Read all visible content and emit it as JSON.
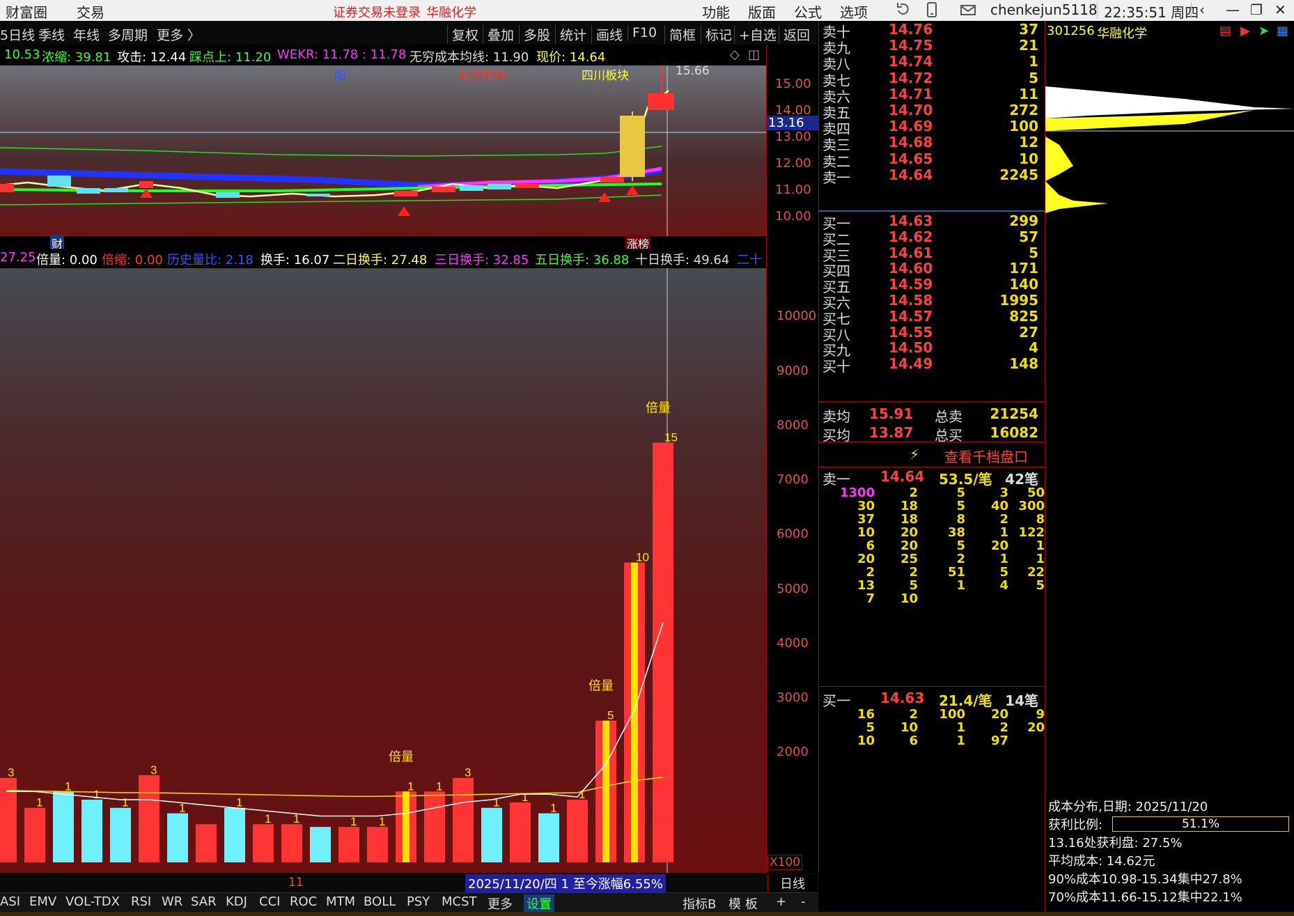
{
  "menu": {
    "left_items": [
      "财富圈",
      "交易"
    ],
    "notice": "证券交易未登录",
    "stock_name": "华融化学",
    "right_items": [
      "功能",
      "版面",
      "公式",
      "选项"
    ],
    "user": "chenkejun5118",
    "time": "22:35:51 周四"
  },
  "period_bar": {
    "items": [
      "5日线",
      "季线",
      "年线",
      "多周期",
      "更多 〉"
    ],
    "tools": [
      "复权",
      "叠加",
      "多股",
      "统计",
      "画线",
      "F10",
      "简框",
      "标记",
      "+自选",
      "返回"
    ]
  },
  "indicator_line": [
    {
      "text": "10.53",
      "color": "#33ff33"
    },
    {
      "text": "浓缩: 39.81",
      "color": "#33ff33"
    },
    {
      "text": "攻击: 12.44",
      "color": "#ffffff"
    },
    {
      "text": "踩点上: 11.20",
      "color": "#33ff33"
    },
    {
      "text": "WEKR: 11.78 : 11.78",
      "color": "#ff33ff"
    },
    {
      "text": "无穷成本均线: 11.90",
      "color": "#dddddd"
    },
    {
      "text": "现价: 14.64",
      "color": "#ffff33"
    }
  ],
  "price_chart": {
    "labels": [
      {
        "text": "阳",
        "color": "#3355ff"
      },
      {
        "text": "化学原料",
        "color": "#ff3333"
      },
      {
        "text": "四川板块",
        "color": "#ffff33"
      }
    ],
    "high_label": "15.66",
    "crosshair_price": "13.16",
    "y_ticks": [
      "15.00",
      "14.00",
      "13.00",
      "12.00",
      "11.00",
      "10.00"
    ],
    "tag_cai": "财",
    "tag_zhangbang": "涨榜"
  },
  "volume_indicator_line": [
    {
      "text": "27.25",
      "color": "#ff33ff"
    },
    {
      "text": "倍量: 0.00",
      "color": "#ffffff"
    },
    {
      "text": "倍缩: 0.00",
      "color": "#ff3333"
    },
    {
      "text": "历史量比: 2.18",
      "color": "#3355ff"
    },
    {
      "text": "换手: 16.07",
      "color": "#ffffff"
    },
    {
      "text": "二日换手: 27.48",
      "color": "#ffff33"
    },
    {
      "text": "三日换手: 32.85",
      "color": "#ff33ff"
    },
    {
      "text": "五日换手: 36.88",
      "color": "#33ff33"
    },
    {
      "text": "十日换手: 49.64",
      "color": "#dddddd"
    },
    {
      "text": "二十",
      "color": "#3355ff"
    }
  ],
  "chart_data": {
    "type": "bar",
    "title": "",
    "xlabel": "",
    "ylabel": "",
    "ylim": [
      0,
      10900
    ],
    "y_ticks": [
      2000,
      3000,
      4000,
      5000,
      6000,
      7000,
      8000,
      9000,
      10000
    ],
    "y_unit_label": "X100",
    "volumes": [
      1550,
      1000,
      1300,
      1150,
      1000,
      1600,
      900,
      700,
      1000,
      700,
      700,
      650,
      650,
      650,
      1300,
      1300,
      1550,
      1000,
      1100,
      900,
      1150,
      2600,
      5500,
      7700
    ],
    "colors": [
      "red",
      "red",
      "cyan",
      "cyan",
      "cyan",
      "red",
      "cyan",
      "red",
      "cyan",
      "red",
      "red",
      "cyan",
      "red",
      "red",
      "yellow",
      "red",
      "red",
      "cyan",
      "red",
      "cyan",
      "red",
      "yellow",
      "yellow",
      "red"
    ],
    "bar_labels": [
      "3",
      "1",
      "1",
      "1",
      "1",
      "3",
      "1",
      "",
      "1",
      "1",
      "1",
      "",
      "1",
      "1",
      "1",
      "1",
      "3",
      "1",
      "1",
      "1",
      "1",
      "5",
      "10",
      "15"
    ],
    "annotations": [
      "倍量",
      "倍量",
      "倍量"
    ]
  },
  "date_bar": {
    "month": "11",
    "range_text": "2025/11/20/四 1 至今涨幅6.55%",
    "period": "日线"
  },
  "tabs": [
    "ASI",
    "EMV",
    "VOL-TDX",
    "RSI",
    "WR",
    "SAR",
    "KDJ",
    "CCI",
    "ROC",
    "MTM",
    "BOLL",
    "PSY",
    "MCST",
    "更多",
    "设置"
  ],
  "tabs_right": [
    "指标B",
    "模 板",
    "+",
    "-"
  ],
  "orderbook": {
    "asks": [
      {
        "label": "卖十",
        "price": "14.76",
        "vol": "37"
      },
      {
        "label": "卖九",
        "price": "14.75",
        "vol": "21"
      },
      {
        "label": "卖八",
        "price": "14.74",
        "vol": "1"
      },
      {
        "label": "卖七",
        "price": "14.72",
        "vol": "5"
      },
      {
        "label": "卖六",
        "price": "14.71",
        "vol": "11"
      },
      {
        "label": "卖五",
        "price": "14.70",
        "vol": "272"
      },
      {
        "label": "卖四",
        "price": "14.69",
        "vol": "100"
      },
      {
        "label": "卖三",
        "price": "14.68",
        "vol": "12"
      },
      {
        "label": "卖二",
        "price": "14.65",
        "vol": "10"
      },
      {
        "label": "卖一",
        "price": "14.64",
        "vol": "2245"
      }
    ],
    "bids": [
      {
        "label": "买一",
        "price": "14.63",
        "vol": "299"
      },
      {
        "label": "买二",
        "price": "14.62",
        "vol": "57"
      },
      {
        "label": "买三",
        "price": "14.61",
        "vol": "5"
      },
      {
        "label": "买四",
        "price": "14.60",
        "vol": "171"
      },
      {
        "label": "买五",
        "price": "14.59",
        "vol": "140"
      },
      {
        "label": "买六",
        "price": "14.58",
        "vol": "1995"
      },
      {
        "label": "买七",
        "price": "14.57",
        "vol": "825"
      },
      {
        "label": "买八",
        "price": "14.55",
        "vol": "27"
      },
      {
        "label": "买九",
        "price": "14.50",
        "vol": "4"
      },
      {
        "label": "买十",
        "price": "14.49",
        "vol": "148"
      }
    ],
    "avg_sell_label": "卖均",
    "avg_sell": "15.91",
    "total_sell_label": "总卖",
    "total_sell": "21254",
    "avg_buy_label": "买均",
    "avg_buy": "13.87",
    "total_buy_label": "总买",
    "total_buy": "16082",
    "depth_link": "查看千档盘口",
    "sell1_detail": {
      "label": "卖一",
      "price": "14.64",
      "per": "53.5/笔",
      "count": "42笔"
    },
    "sell1_orders": [
      [
        "1300",
        "2",
        "5",
        "3",
        "50"
      ],
      [
        "30",
        "18",
        "5",
        "40",
        "300"
      ],
      [
        "37",
        "18",
        "8",
        "2",
        "8"
      ],
      [
        "10",
        "20",
        "38",
        "1",
        "122"
      ],
      [
        "6",
        "20",
        "5",
        "20",
        "1"
      ],
      [
        "20",
        "25",
        "2",
        "1",
        "1"
      ],
      [
        "2",
        "2",
        "51",
        "5",
        "22"
      ],
      [
        "13",
        "5",
        "1",
        "4",
        "5"
      ],
      [
        "7",
        "10",
        "",
        "",
        ""
      ]
    ],
    "buy1_detail": {
      "label": "买一",
      "price": "14.63",
      "per": "21.4/笔",
      "count": "14笔"
    },
    "buy1_orders": [
      [
        "16",
        "2",
        "100",
        "20",
        "9"
      ],
      [
        "5",
        "10",
        "1",
        "2",
        "20"
      ],
      [
        "10",
        "6",
        "1",
        "97",
        ""
      ]
    ]
  },
  "right_panel": {
    "code": "301256",
    "name": "华融化学",
    "cost_date": "成本分布,日期: 2025/11/20",
    "profit_ratio_label": "获利比例:",
    "profit_ratio_value": "51.1%",
    "profit_ratio": 0.511,
    "profit_at": "13.16处获利盘: 27.5%",
    "avg_cost": "平均成本: 14.62元",
    "cost90": "90%成本10.98-15.34集中27.8%",
    "cost70": "70%成本11.66-15.12集中22.1%"
  }
}
